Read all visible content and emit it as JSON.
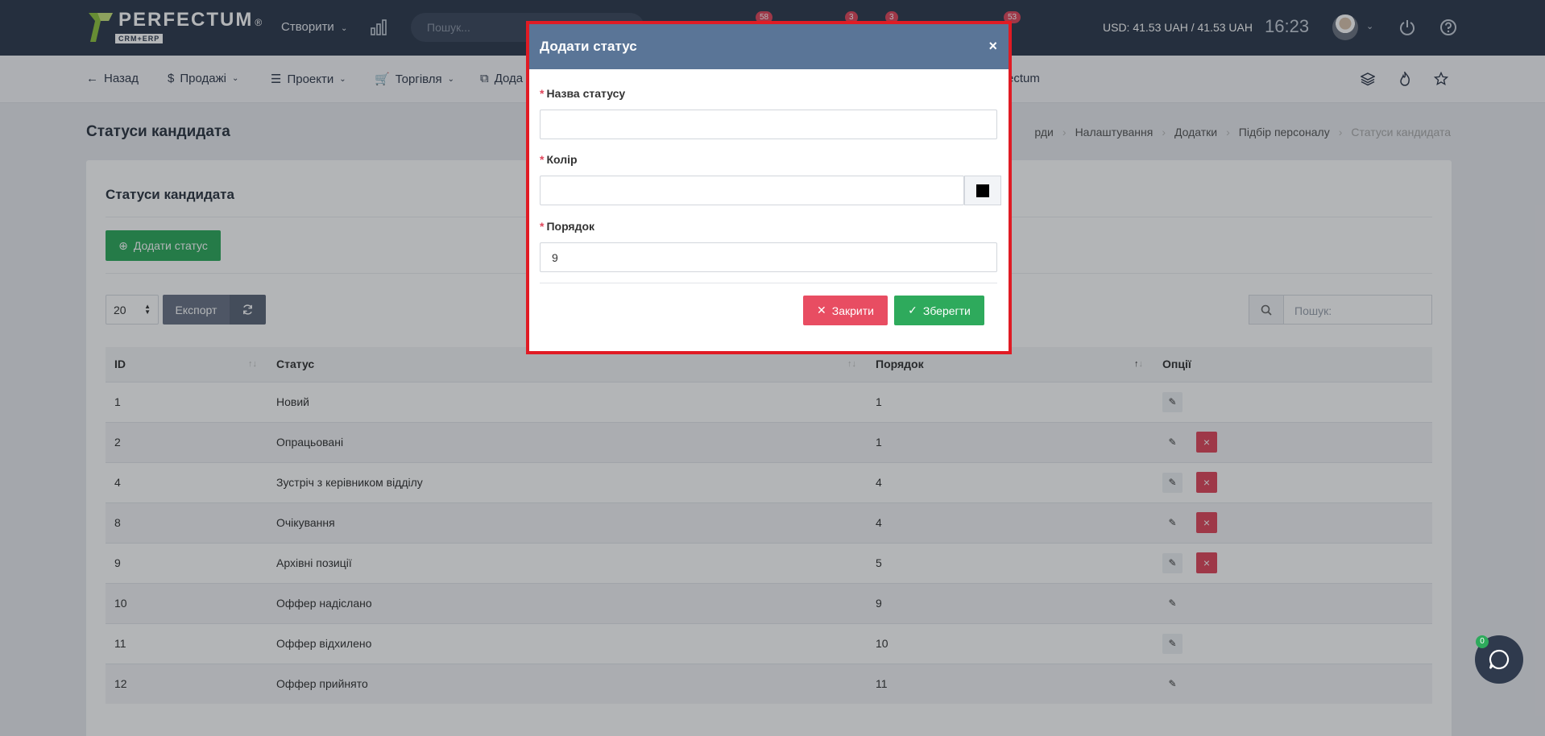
{
  "header": {
    "logo_text": "PERFECTUM",
    "logo_sub": "CRM+ERP",
    "logo_reg": "®",
    "create_label": "Створити",
    "search_placeholder": "Пошук...",
    "badges": [
      "58",
      "3",
      "3",
      "53"
    ],
    "currency": "USD: 41.53 UAH / 41.53 UAH",
    "time": "16:23"
  },
  "subnav": {
    "back": "Назад",
    "sales": "Продажі",
    "projects": "Проекти",
    "trade": "Торгівля",
    "addons_partial": "Дода",
    "perfectum_partial": "ectum"
  },
  "page": {
    "title": "Статуси кандидата",
    "breadcrumb": [
      "рди",
      "Налаштування",
      "Додатки",
      "Підбір персоналу",
      "Статуси кандидата"
    ]
  },
  "card": {
    "title": "Статуси кандидата",
    "add_button": "Додати статус",
    "page_size": "20",
    "export_label": "Експорт",
    "search_placeholder": "Пошук:"
  },
  "table": {
    "columns": [
      "ID",
      "Статус",
      "Порядок",
      "Опції"
    ],
    "rows": [
      {
        "id": "1",
        "status": "Новий",
        "order": "1",
        "deletable": false
      },
      {
        "id": "2",
        "status": "Опрацьовані",
        "order": "1",
        "deletable": true
      },
      {
        "id": "4",
        "status": "Зустріч з керівником відділу",
        "order": "4",
        "deletable": true
      },
      {
        "id": "8",
        "status": "Очікування",
        "order": "4",
        "deletable": true
      },
      {
        "id": "9",
        "status": "Архівні позиції",
        "order": "5",
        "deletable": true
      },
      {
        "id": "10",
        "status": "Оффер надіслано",
        "order": "9",
        "deletable": false
      },
      {
        "id": "11",
        "status": "Оффер відхилено",
        "order": "10",
        "deletable": false
      },
      {
        "id": "12",
        "status": "Оффер прийнято",
        "order": "11",
        "deletable": false
      }
    ]
  },
  "modal": {
    "title": "Додати статус",
    "close_symbol": "×",
    "name_label": "Назва статусу",
    "name_value": "",
    "color_label": "Колір",
    "color_value": "",
    "color_swatch": "#000000",
    "order_label": "Порядок",
    "order_value": "9",
    "required_mark": "*",
    "close_button": "Закрити",
    "save_button": "Зберегти"
  },
  "chat": {
    "badge": "0"
  },
  "colors": {
    "header_bg": "#2f3a4d",
    "modal_header": "#5a7597",
    "highlight_border": "#e01b24",
    "success": "#2eaa5c",
    "danger": "#e84d62"
  }
}
